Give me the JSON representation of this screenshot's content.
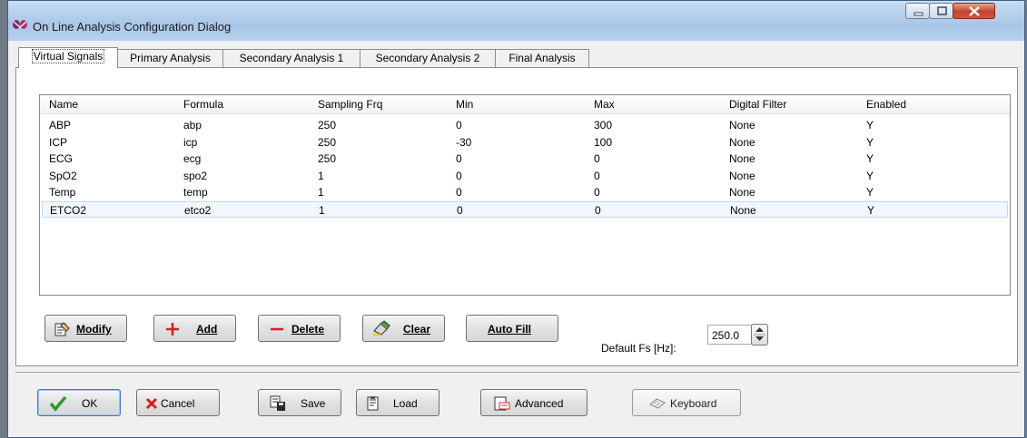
{
  "window": {
    "title": "On Line Analysis Configuration Dialog"
  },
  "tabs": [
    {
      "label": "Virtual Signals",
      "active": true
    },
    {
      "label": "Primary Analysis"
    },
    {
      "label": "Secondary Analysis 1"
    },
    {
      "label": "Secondary Analysis 2"
    },
    {
      "label": "Final Analysis"
    }
  ],
  "table": {
    "columns": [
      "Name",
      "Formula",
      "Sampling Frq",
      "Min",
      "Max",
      "Digital Filter",
      "Enabled"
    ],
    "rows": [
      [
        "ABP",
        "abp",
        "250",
        "0",
        "300",
        "None",
        "Y"
      ],
      [
        "ICP",
        "icp",
        "250",
        "-30",
        "100",
        "None",
        "Y"
      ],
      [
        "ECG",
        "ecg",
        "250",
        "0",
        "0",
        "None",
        "Y"
      ],
      [
        "SpO2",
        "spo2",
        "1",
        "0",
        "0",
        "None",
        "Y"
      ],
      [
        "Temp",
        "temp",
        "1",
        "0",
        "0",
        "None",
        "Y"
      ],
      [
        "ETCO2",
        "etco2",
        "1",
        "0",
        "0",
        "None",
        "Y"
      ]
    ],
    "selected_row": 5
  },
  "actions": {
    "modify": "Modify",
    "add": "Add",
    "delete": "Delete",
    "clear": "Clear",
    "autofill": "Auto Fill"
  },
  "default_fs": {
    "label": "Default Fs [Hz]:",
    "value": "250.0"
  },
  "bottom": {
    "ok": "OK",
    "cancel": "Cancel",
    "save": "Save",
    "load": "Load",
    "advanced": "Advanced",
    "keyboard": "Keyboard"
  },
  "colors": {
    "accent": "#3b79c9",
    "add_red": "#d21f1f",
    "ok_green": "#2e9a2e"
  }
}
